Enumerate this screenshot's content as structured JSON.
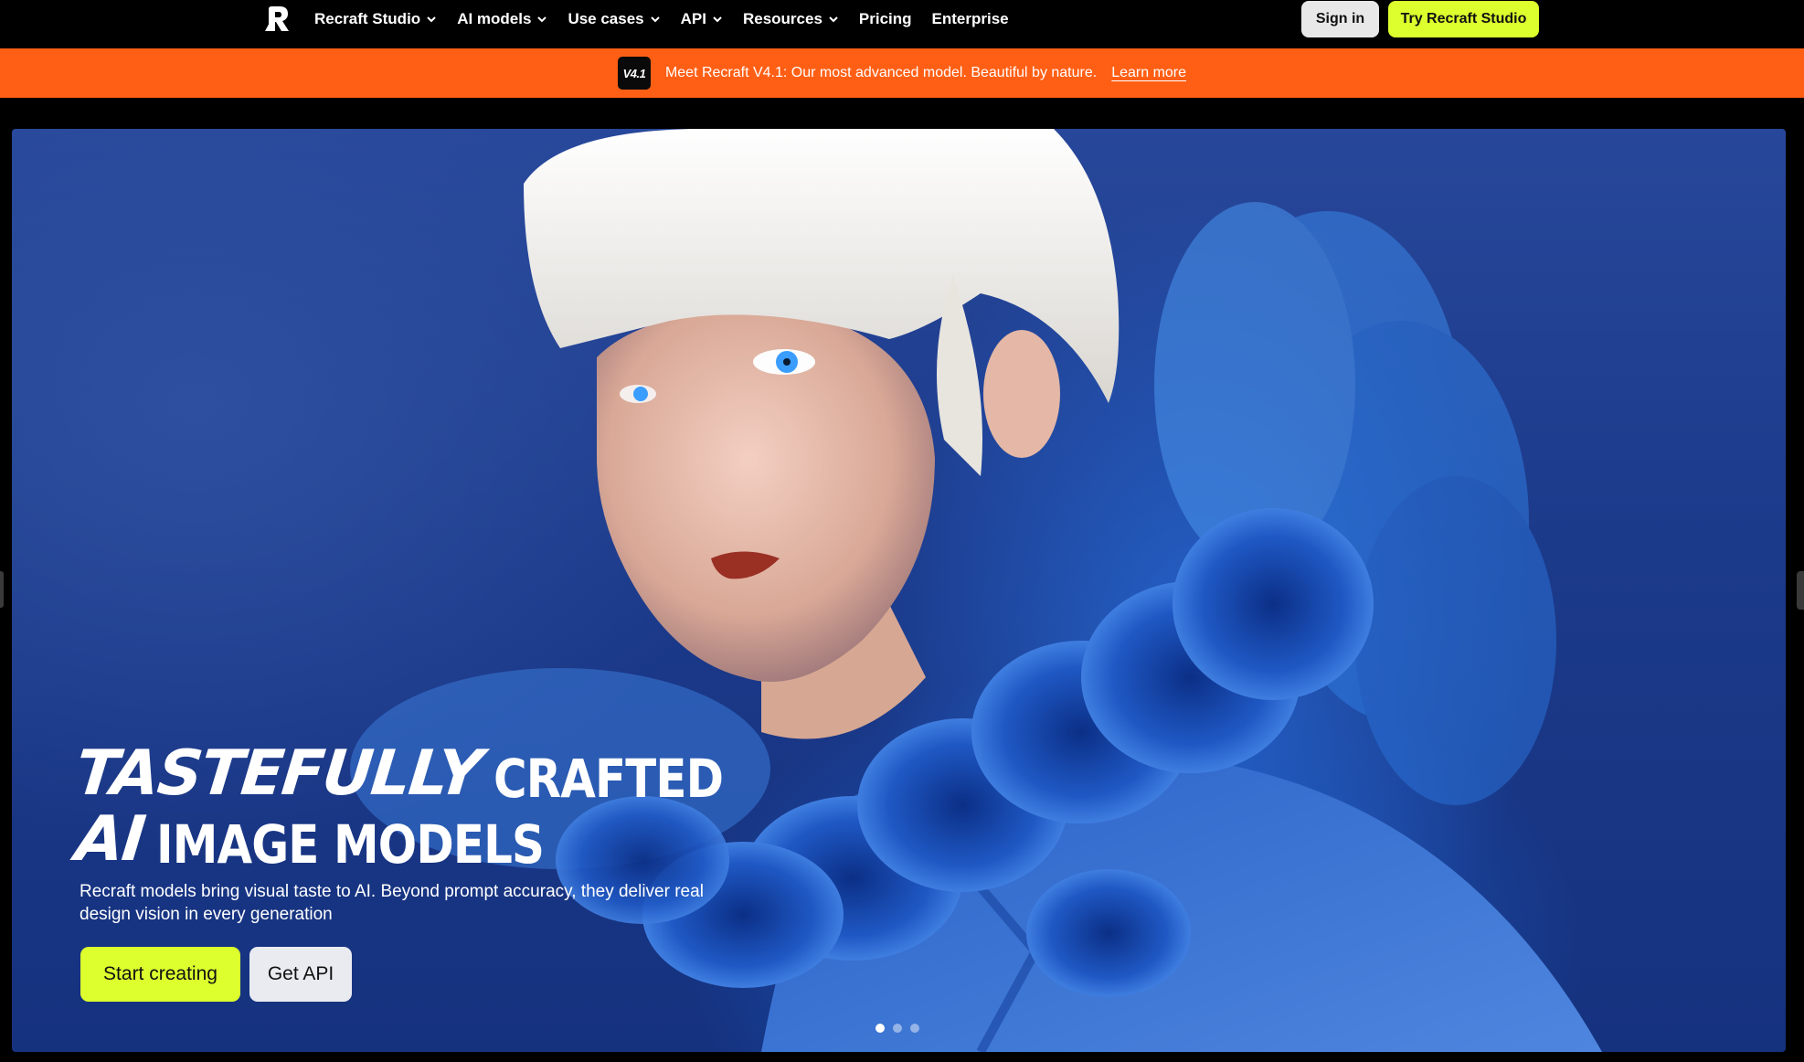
{
  "nav": {
    "logo_icon": "recraft-logo-icon",
    "items": [
      {
        "label": "Recraft Studio",
        "dropdown": true
      },
      {
        "label": "AI models",
        "dropdown": true
      },
      {
        "label": "Use cases",
        "dropdown": true
      },
      {
        "label": "API",
        "dropdown": true
      },
      {
        "label": "Resources",
        "dropdown": true
      },
      {
        "label": "Pricing",
        "dropdown": false
      },
      {
        "label": "Enterprise",
        "dropdown": false
      }
    ],
    "signin_label": "Sign in",
    "try_label": "Try Recraft Studio"
  },
  "banner": {
    "badge": "V4.1",
    "text": "Meet Recraft V4.1: Our most advanced model. Beautiful by nature.",
    "link": "Learn more",
    "color": "#ff5f15"
  },
  "hero": {
    "headline_line1_italic": "TASTEFULLY",
    "headline_line1_regular": "CRAFTED",
    "headline_line2_italic": "AI",
    "headline_line2_regular": "IMAGE MODELS",
    "subtext": "Recraft models bring visual taste to AI. Beyond prompt accuracy, they deliver real design vision in every generation",
    "primary_button": "Start creating",
    "secondary_button": "Get API",
    "carousel": {
      "count": 3,
      "active_index": 0
    }
  },
  "colors": {
    "accent": "#dcff2d",
    "background": "#000000",
    "banner": "#ff5f15"
  }
}
